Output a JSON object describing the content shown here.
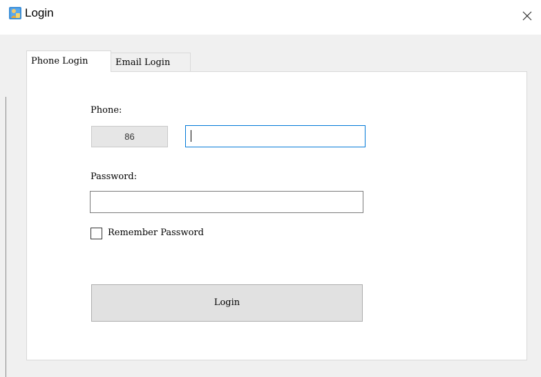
{
  "window": {
    "title": "Login",
    "icon": "login-app-icon",
    "close_icon": "close-icon"
  },
  "tabs": [
    {
      "label": "Phone Login",
      "selected": true
    },
    {
      "label": "Email Login",
      "selected": false
    }
  ],
  "form": {
    "phone_label": "Phone:",
    "country_code": "86",
    "phone_value": "",
    "password_label": "Password:",
    "password_value": "",
    "remember_label": "Remember Password",
    "remember_checked": false,
    "login_label": "Login"
  },
  "colors": {
    "focus_border": "#0078d7",
    "button_bg": "#e1e1e1",
    "window_bg": "#f0f0f0"
  }
}
